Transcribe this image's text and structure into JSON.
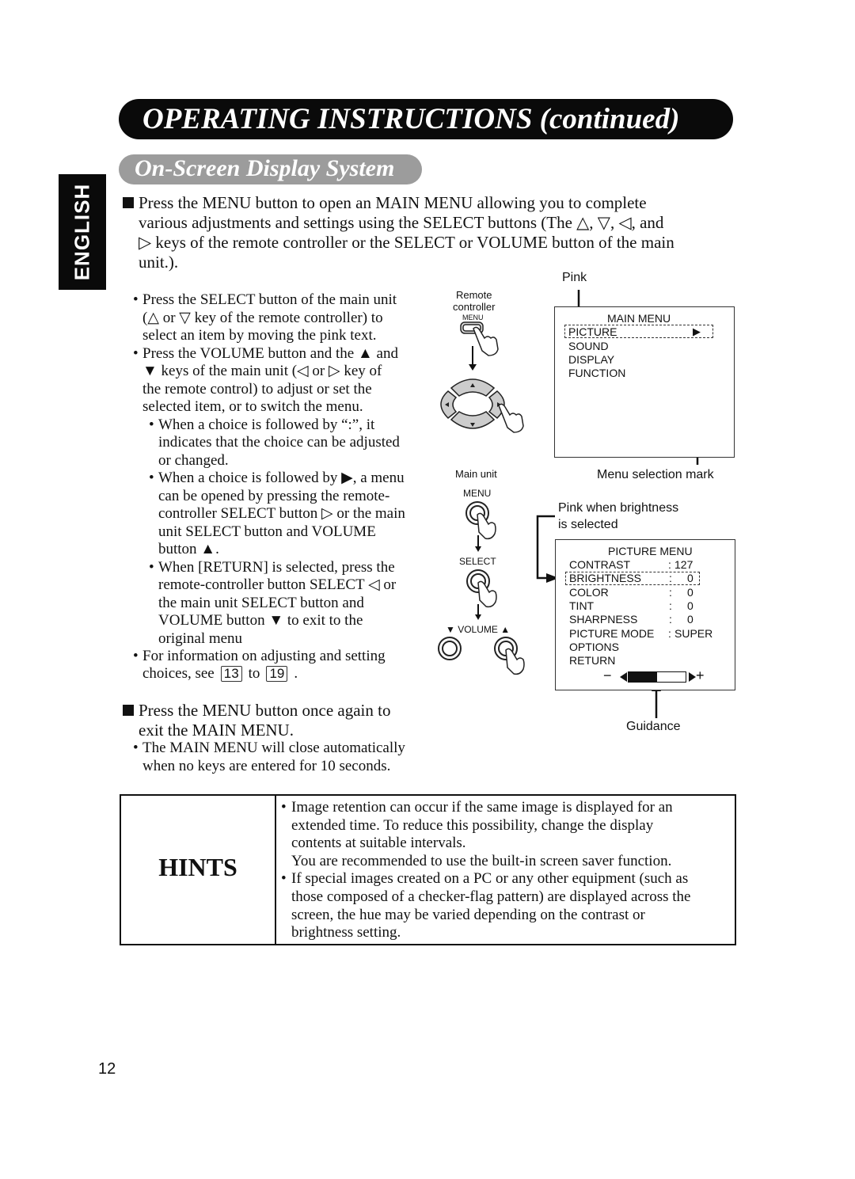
{
  "header": {
    "title": "OPERATING INSTRUCTIONS (continued)"
  },
  "section": {
    "title": "On-Screen Display System"
  },
  "side_tab": {
    "label": "ENGLISH"
  },
  "intro": {
    "lines": [
      "Press the MENU button to open an MAIN MENU allowing you to complete",
      "various adjustments and settings using the SELECT buttons (The △, ▽, ◁, and",
      "▷ keys of the remote controller or the SELECT or VOLUME button of the main",
      "unit.)."
    ]
  },
  "instructions": [
    {
      "level": 1,
      "bullet": true,
      "text": "Press the SELECT button of the main unit"
    },
    {
      "level": 1,
      "text": "(△ or ▽ key of the remote controller) to"
    },
    {
      "level": 1,
      "text": "select an item by moving the pink text."
    },
    {
      "level": 1,
      "bullet": true,
      "text": "Press the VOLUME button and the ▲ and"
    },
    {
      "level": 1,
      "text": "▼ keys of the main unit (◁ or ▷ key of"
    },
    {
      "level": 1,
      "text": "the remote control) to adjust or set the"
    },
    {
      "level": 1,
      "text": "selected item, or to switch the menu."
    },
    {
      "level": 2,
      "bullet": true,
      "text": "When a choice is followed by “:”, it"
    },
    {
      "level": 2,
      "text": "indicates that the choice can be adjusted"
    },
    {
      "level": 2,
      "text": "or changed."
    },
    {
      "level": 2,
      "bullet": true,
      "text": "When a choice is followed by ▶, a menu"
    },
    {
      "level": 2,
      "text": "can be opened by pressing the remote-"
    },
    {
      "level": 2,
      "text": "controller SELECT button ▷ or the main"
    },
    {
      "level": 2,
      "text": "unit SELECT button and VOLUME"
    },
    {
      "level": 2,
      "text": "button ▲."
    },
    {
      "level": 2,
      "bullet": true,
      "text": "When [RETURN] is selected, press the"
    },
    {
      "level": 2,
      "text": "remote-controller button SELECT ◁ or"
    },
    {
      "level": 2,
      "text": "the main unit SELECT button and"
    },
    {
      "level": 2,
      "text": "VOLUME button ▼ to exit to the"
    },
    {
      "level": 2,
      "text": "original menu"
    },
    {
      "level": 1,
      "bullet": true,
      "text": "For information on adjusting and setting"
    }
  ],
  "page_ref_line": {
    "prefix": "choices, see",
    "from": "13",
    "mid": "to",
    "to": "19",
    "suffix": "."
  },
  "exit": {
    "lines": [
      "Press the MENU button once again to",
      "exit the MAIN MENU."
    ],
    "bullets": [
      {
        "bullet": true,
        "text": "The MAIN MENU will close automatically"
      },
      {
        "text": "when no keys are entered for 10 seconds."
      }
    ]
  },
  "diagram": {
    "remote_label": "Remote\ncontroller",
    "remote_label_1": "Remote",
    "remote_label_2": "controller",
    "remote_menu_key": "MENU",
    "main_unit_label": "Main unit",
    "main_menu_key": "MENU",
    "select_key": "SELECT",
    "volume_key": "▼ VOLUME ▲",
    "pink_label": "Pink",
    "menu_selection_label": "Menu selection mark",
    "pink_brightness_1": "Pink when brightness",
    "pink_brightness_2": "is selected",
    "guidance_label": "Guidance",
    "main_menu": {
      "title": "MAIN MENU",
      "items": [
        "PICTURE",
        "SOUND",
        "DISPLAY",
        "FUNCTION"
      ],
      "selected": "PICTURE",
      "submenu_mark": "▶"
    },
    "picture_menu": {
      "title": "PICTURE MENU",
      "items": [
        {
          "name": "CONTRAST",
          "sep": ":",
          "value": "127"
        },
        {
          "name": "BRIGHTNESS",
          "sep": ":",
          "value": "0"
        },
        {
          "name": "COLOR",
          "sep": ":",
          "value": "0"
        },
        {
          "name": "TINT",
          "sep": ":",
          "value": "0"
        },
        {
          "name": "SHARPNESS",
          "sep": ":",
          "value": "0"
        },
        {
          "name": "PICTURE MODE",
          "sep": ":",
          "value": "SUPER"
        },
        {
          "name": "OPTIONS"
        },
        {
          "name": "RETURN"
        }
      ],
      "selected": "BRIGHTNESS",
      "guidance": {
        "minus": "−",
        "plus": "+",
        "level_fraction": 0.5
      }
    }
  },
  "hints": {
    "title": "HINTS",
    "lines": [
      {
        "bullet": true,
        "text": "Image retention can occur if the same image is displayed for an"
      },
      {
        "text": "extended time. To reduce this possibility, change the display"
      },
      {
        "text": "contents at suitable intervals."
      },
      {
        "text": " You are recommended to use the built-in screen saver function."
      },
      {
        "bullet": true,
        "text": "If special images created on a PC or any other equipment (such as"
      },
      {
        "text": "those composed of a checker-flag pattern) are displayed across the"
      },
      {
        "text": "screen, the hue may be varied depending on the contrast or"
      },
      {
        "text": "brightness setting."
      }
    ]
  },
  "page_number": "12"
}
